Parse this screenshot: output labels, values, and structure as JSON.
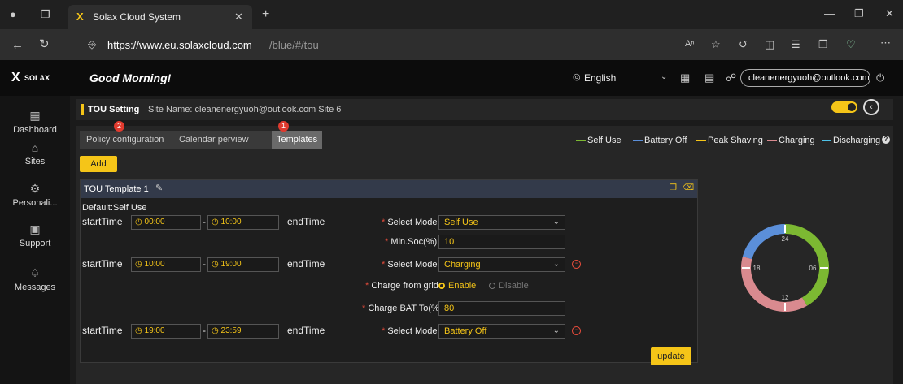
{
  "browser": {
    "tab_title": "Solax Cloud System",
    "url_host": "https://www.eu.solaxcloud.com",
    "url_path": "/blue/#/tou"
  },
  "header": {
    "logo_text": "SOLAX",
    "greeting": "Good Morning!",
    "language": "English",
    "account": "cleanenergyuoh@outlook.com"
  },
  "sidebar": {
    "items": [
      {
        "label": "Dashboard",
        "icon": "dashboard-icon"
      },
      {
        "label": "Sites",
        "icon": "home-icon"
      },
      {
        "label": "Personali...",
        "icon": "settings-icon"
      },
      {
        "label": "Support",
        "icon": "monitor-icon"
      },
      {
        "label": "Messages",
        "icon": "bell-icon"
      }
    ]
  },
  "setting": {
    "title": "TOU Setting",
    "site": "Site Name: cleanenergyuoh@outlook.com Site 6"
  },
  "tabs": [
    {
      "label": "Policy configuration",
      "badge": "2"
    },
    {
      "label": "Calendar perview",
      "badge": ""
    },
    {
      "label": "Templates",
      "badge": "1"
    }
  ],
  "legend": [
    {
      "label": "Self Use",
      "color": "#7cb832"
    },
    {
      "label": "Battery Off",
      "color": "#5b8fd9"
    },
    {
      "label": "Peak Shaving",
      "color": "#f5c518"
    },
    {
      "label": "Charging",
      "color": "#d98a8f"
    },
    {
      "label": "Discharging",
      "color": "#4fc3e8"
    }
  ],
  "add_label": "Add",
  "template": {
    "name": "TOU Template 1",
    "default": "Default:Self Use",
    "rows": [
      {
        "start": "00:00",
        "end": "10:00",
        "mode": "Self Use"
      },
      {
        "start": "10:00",
        "end": "19:00",
        "mode": "Charging"
      },
      {
        "start": "19:00",
        "end": "23:59",
        "mode": "Battery Off"
      }
    ],
    "start_label": "startTime",
    "end_label": "endTime",
    "select_mode_label": "Select Mode",
    "min_soc_label": "Min.Soc(%)",
    "min_soc_value": "10",
    "charge_grid_label": "Charge from grid",
    "enable_label": "Enable",
    "disable_label": "Disable",
    "charge_bat_label": "Charge BAT To(%)",
    "charge_bat_value": "80"
  },
  "update_label": "update",
  "clock": {
    "labels": {
      "top": "24",
      "right": "06",
      "bottom": "12",
      "left": "18"
    },
    "segments": [
      {
        "from": 0,
        "to": 10,
        "mode": "Self Use",
        "color": "#7cb832"
      },
      {
        "from": 10,
        "to": 19,
        "mode": "Charging",
        "color": "#d98a8f"
      },
      {
        "from": 19,
        "to": 24,
        "mode": "Battery Off",
        "color": "#5b8fd9"
      }
    ]
  }
}
